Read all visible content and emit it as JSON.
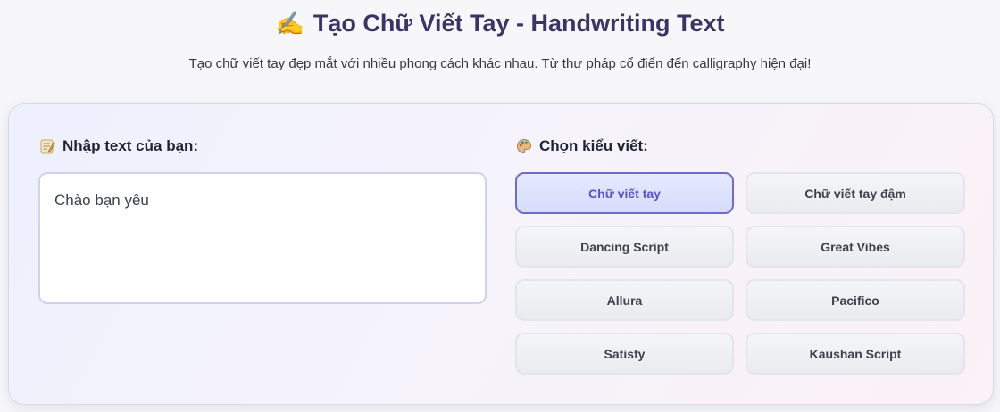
{
  "header": {
    "title_icon": "writing-hand-icon",
    "title": "Tạo Chữ Viết Tay - Handwriting Text",
    "subtitle": "Tạo chữ viết tay đẹp mắt với nhiều phong cách khác nhau. Từ thư pháp cổ điển đến calligraphy hiện đại!"
  },
  "input_section": {
    "icon": "memo-icon",
    "label": "Nhập text của bạn:",
    "text_value": "Chào bạn yêu"
  },
  "style_section": {
    "icon": "palette-icon",
    "label": "Chọn kiểu viết:",
    "selected": "Chữ viết tay",
    "options": [
      "Chữ viết tay",
      "Chữ viết tay đậm",
      "Dancing Script",
      "Great Vibes",
      "Allura",
      "Pacifico",
      "Satisfy",
      "Kaushan Script"
    ]
  },
  "colors": {
    "title": "#3b3464",
    "active_border": "#6d6ccc",
    "active_text": "#5a52c6"
  }
}
